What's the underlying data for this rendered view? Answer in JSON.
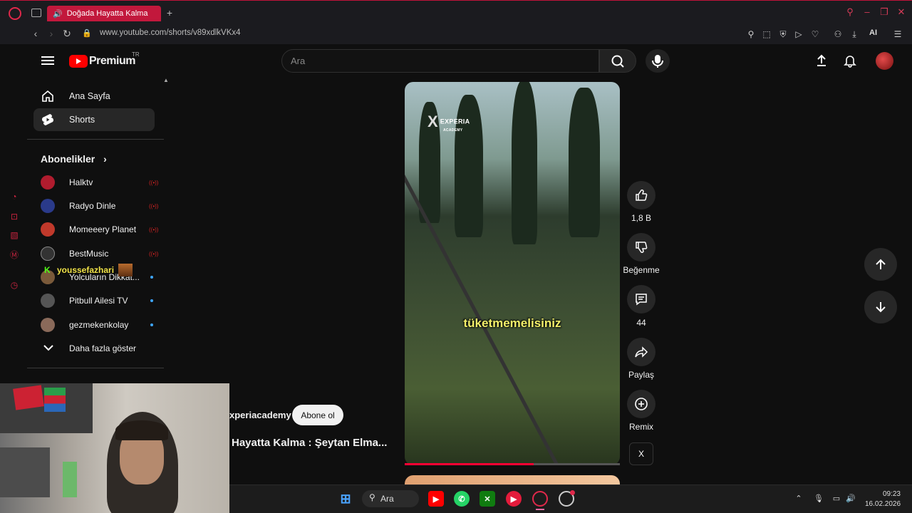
{
  "browser": {
    "tab_title": "Doğada Hayatta Kalma",
    "url": "www.youtube.com/shorts/v89xdlkVKx4",
    "ai_label": "AI"
  },
  "header": {
    "brand": "Premium",
    "region": "TR",
    "search_placeholder": "Ara"
  },
  "sidebar": {
    "items": [
      {
        "label": "Ana Sayfa",
        "icon": "home-icon"
      },
      {
        "label": "Shorts",
        "icon": "shorts-icon",
        "active": true
      }
    ],
    "subscriptions_title": "Abonelikler",
    "subscriptions": [
      {
        "name": "Halktv",
        "status": "live",
        "color": "#b01c2e"
      },
      {
        "name": "Radyo Dinle",
        "status": "live",
        "color": "#2a3a8a"
      },
      {
        "name": "Momeeery Planet",
        "status": "live",
        "color": "#c0392b"
      },
      {
        "name": "BestMusic",
        "status": "live",
        "color": "#333333"
      },
      {
        "name": "Yolcuların Dikkat...",
        "status": "new",
        "color": "#7a5a3a"
      },
      {
        "name": "Pitbull Ailesi TV",
        "status": "new",
        "color": "#555555"
      },
      {
        "name": "gezmekenkolay",
        "status": "new",
        "color": "#8a6a5a"
      }
    ],
    "show_more": "Daha fazla göster"
  },
  "overlay": {
    "username": "youssefazhari",
    "badge": "K"
  },
  "video": {
    "watermark": "EXPERIA",
    "watermark_sub": "ACADEMY",
    "caption": "tüketmemelisiniz",
    "progress": 0.6
  },
  "actions": {
    "likes": "1,8 B",
    "dislike_label": "Beğenme",
    "comments": "44",
    "share_label": "Paylaş",
    "remix_label": "Remix"
  },
  "channel": {
    "name": "xperiacademy",
    "subscribe": "Abone ol",
    "title": "Hayatta Kalma : Şeytan Elma..."
  },
  "taskbar": {
    "search": "Ara",
    "time": "09:23",
    "date": "16.02.2026"
  },
  "colors": {
    "accent": "#ff0000",
    "opera": "#c2183c",
    "live": "#cc2222"
  }
}
